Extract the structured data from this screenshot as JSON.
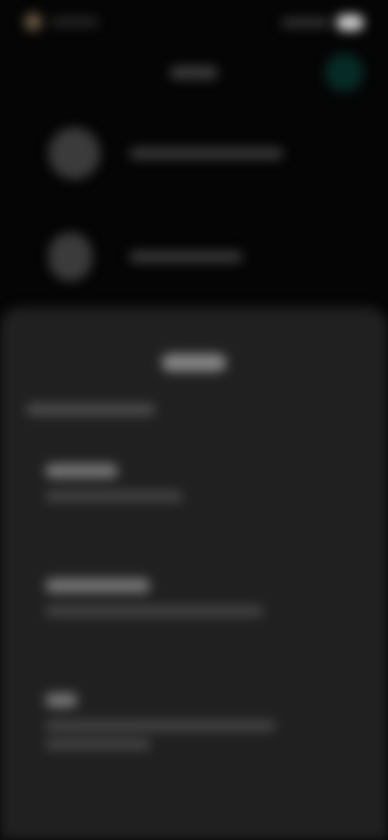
{
  "status_bar": {
    "time": "",
    "battery": ""
  },
  "top": {
    "title": "",
    "rows": [
      {
        "label": ""
      },
      {
        "label": ""
      }
    ]
  },
  "sheet": {
    "title": "",
    "subtitle": "",
    "options": [
      {
        "title": "",
        "description": ""
      },
      {
        "title": "",
        "description": ""
      },
      {
        "title": "",
        "description": "",
        "description_2": ""
      }
    ]
  },
  "colors": {
    "background": "#050505",
    "sheet": "#202020",
    "accent": "#062b26"
  }
}
